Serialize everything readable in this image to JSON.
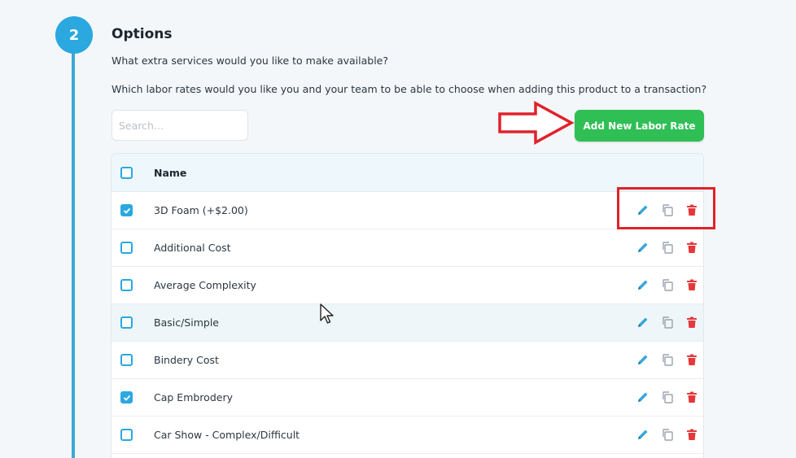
{
  "step": {
    "number": "2"
  },
  "section": {
    "title": "Options",
    "subtitle": "What extra services would you like to make available?",
    "question": "Which labor rates would you like you and your team to be able to choose when adding this product to a transaction?"
  },
  "search": {
    "placeholder": "Search..."
  },
  "add_button": {
    "label": "Add New Labor Rate"
  },
  "table": {
    "header": {
      "name": "Name"
    },
    "rows": [
      {
        "name": "3D Foam (+$2.00)",
        "checked": true
      },
      {
        "name": "Additional Cost",
        "checked": false
      },
      {
        "name": "Average Complexity",
        "checked": false
      },
      {
        "name": "Basic/Simple",
        "checked": false
      },
      {
        "name": "Bindery Cost",
        "checked": false
      },
      {
        "name": "Cap Embrodery",
        "checked": true
      },
      {
        "name": "Car Show - Complex/Difficult",
        "checked": false
      }
    ]
  },
  "colors": {
    "accent": "#2aa8df",
    "button_green": "#2fbf55",
    "delete_red": "#e5383b",
    "annotation_red": "#e0222b"
  },
  "icons": [
    "pencil-icon",
    "copy-icon",
    "trash-icon",
    "arrow-annotation",
    "cursor-pointer"
  ]
}
